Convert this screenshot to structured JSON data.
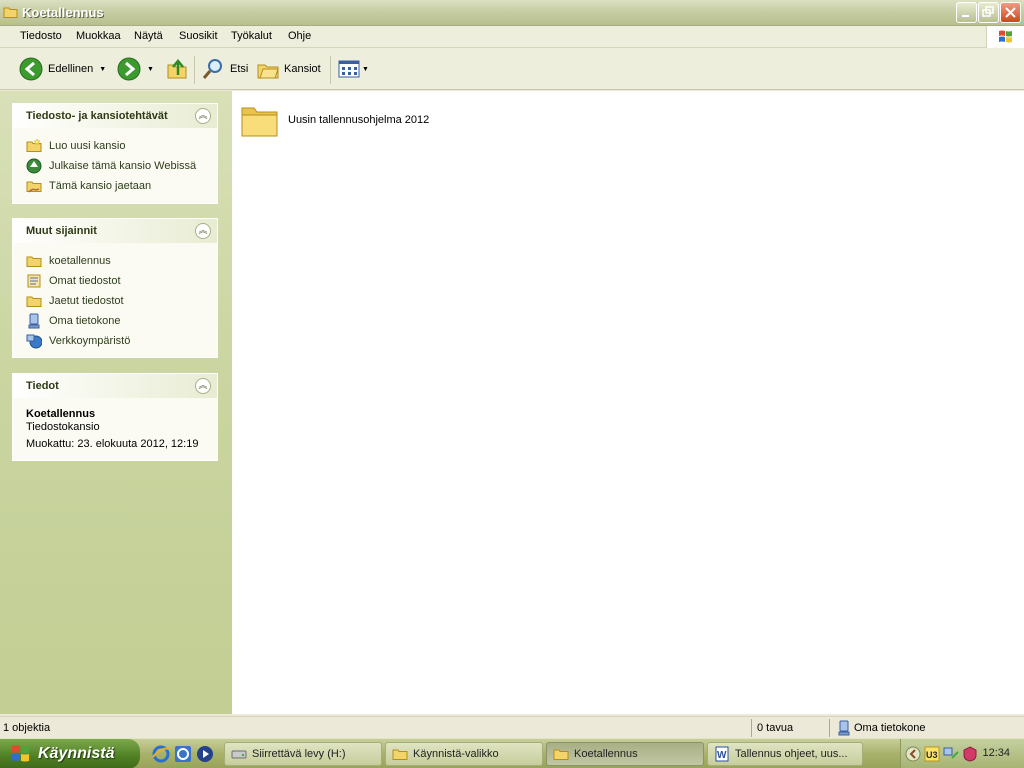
{
  "window": {
    "title": "Koetallennus"
  },
  "menu": {
    "items": [
      "Tiedosto",
      "Muokkaa",
      "Näytä",
      "Suosikit",
      "Työkalut",
      "Ohje"
    ]
  },
  "toolbar": {
    "back_label": "Edellinen",
    "search_label": "Etsi",
    "folders_label": "Kansiot"
  },
  "tasks": {
    "file_tasks": {
      "title": "Tiedosto- ja kansiotehtävät",
      "items": [
        "Luo uusi kansio",
        "Julkaise tämä kansio Webissä",
        "Tämä kansio jaetaan"
      ]
    },
    "other_places": {
      "title": "Muut sijainnit",
      "items": [
        "koetallennus",
        "Omat tiedostot",
        "Jaetut tiedostot",
        "Oma tietokone",
        "Verkkoympäristö"
      ]
    },
    "details": {
      "title": "Tiedot",
      "name": "Koetallennus",
      "type": "Tiedostokansio",
      "modified": "Muokattu: 23. elokuuta 2012, 12:19"
    }
  },
  "content": {
    "items": [
      {
        "name": "Uusin tallennusohjelma 2012",
        "icon": "folder-icon"
      }
    ]
  },
  "status": {
    "count": "1 objektia",
    "size": "0 tavua",
    "location": "Oma tietokone"
  },
  "taskbar": {
    "start_label": "Käynnistä",
    "tasks": [
      "Siirrettävä levy (H:)",
      "Käynnistä-valikko",
      "Koetallennus",
      "Tallennus ohjeet, uus..."
    ],
    "clock": "12:34"
  }
}
